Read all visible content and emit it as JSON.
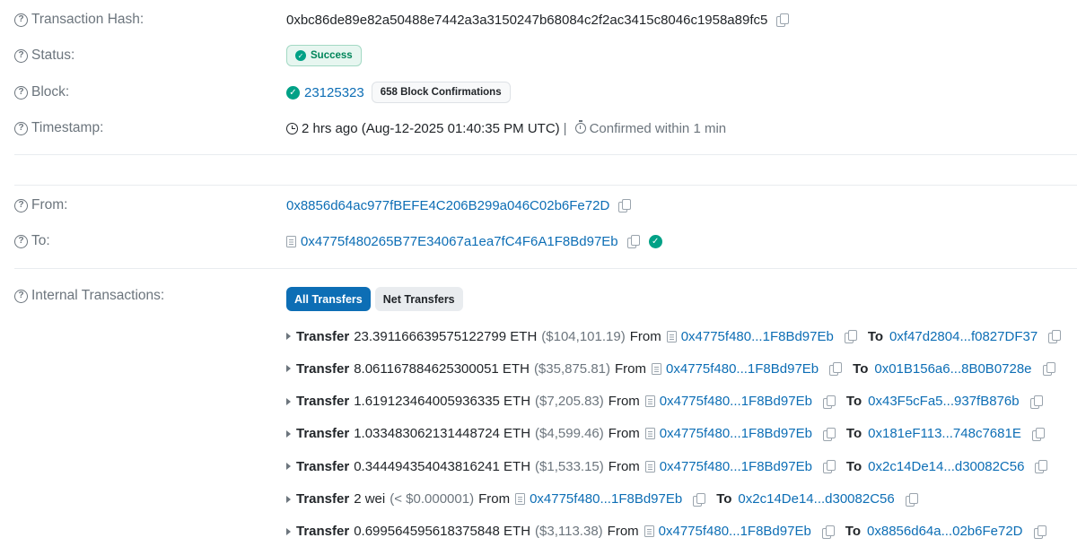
{
  "labels": {
    "tx_hash": "Transaction Hash:",
    "status": "Status:",
    "block": "Block:",
    "timestamp": "Timestamp:",
    "from": "From:",
    "to": "To:",
    "internal": "Internal Transactions:"
  },
  "tx_hash": "0xbc86de89e82a50488e7442a3a3150247b68084c2f2ac3415c8046c1958a89fc5",
  "status": "Success",
  "block": {
    "number": "23125323",
    "confirmations": "658 Block Confirmations"
  },
  "timestamp": {
    "text": "2 hrs ago (Aug-12-2025 01:40:35 PM UTC)",
    "separator": "|",
    "confirmed": "Confirmed within 1 min"
  },
  "from_address": "0x8856d64ac977fBEFE4C206B299a046C02b6Fe72D",
  "to_address": "0x4775f480265B77E34067a1ea7fC4F6A1F8Bd97Eb",
  "tabs": [
    "All Transfers",
    "Net Transfers"
  ],
  "words": {
    "transfer": "Transfer",
    "from": "From",
    "to": "To"
  },
  "transfers": [
    {
      "amount": "23.391166639575122799 ETH",
      "usd": "($104,101.19)",
      "from": "0x4775f480...1F8Bd97Eb",
      "to": "0xf47d2804...f0827DF37"
    },
    {
      "amount": "8.061167884625300051 ETH",
      "usd": "($35,875.81)",
      "from": "0x4775f480...1F8Bd97Eb",
      "to": "0x01B156a6...8B0B0728e"
    },
    {
      "amount": "1.619123464005936335 ETH",
      "usd": "($7,205.83)",
      "from": "0x4775f480...1F8Bd97Eb",
      "to": "0x43F5cFa5...937fB876b"
    },
    {
      "amount": "1.033483062131448724 ETH",
      "usd": "($4,599.46)",
      "from": "0x4775f480...1F8Bd97Eb",
      "to": "0x181eF113...748c7681E"
    },
    {
      "amount": "0.344494354043816241 ETH",
      "usd": "($1,533.15)",
      "from": "0x4775f480...1F8Bd97Eb",
      "to": "0x2c14De14...d30082C56"
    },
    {
      "amount": "2 wei",
      "usd": "(< $0.000001)",
      "from": "0x4775f480...1F8Bd97Eb",
      "to": "0x2c14De14...d30082C56"
    },
    {
      "amount": "0.699564595618375848 ETH",
      "usd": "($3,113.38)",
      "from": "0x4775f480...1F8Bd97Eb",
      "to": "0x8856d64a...02b6Fe72D"
    }
  ]
}
